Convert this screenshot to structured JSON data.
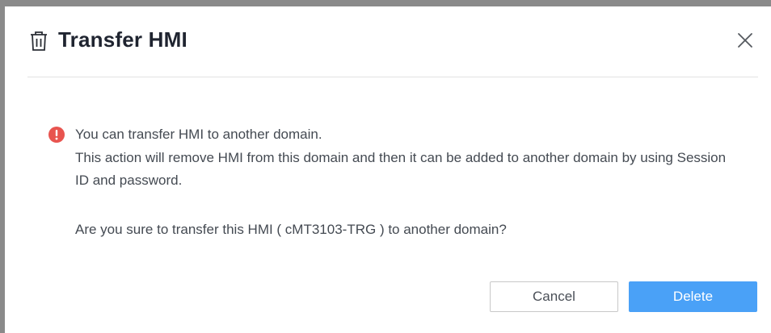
{
  "dialog": {
    "title": "Transfer HMI",
    "title_icon": "trash-icon",
    "close_icon": "close-icon"
  },
  "message": {
    "warning_icon": "warning-icon",
    "warning_color": "#e8544f",
    "line1": "You can transfer HMI to another domain.",
    "line2": "This action will remove HMI from this domain and then it can be added to another domain by using Session ID and password.",
    "question": "Are you sure to transfer this HMI ( cMT3103-TRG ) to another domain?"
  },
  "buttons": {
    "cancel_label": "Cancel",
    "delete_label": "Delete",
    "primary_color": "#4aa1f7"
  }
}
